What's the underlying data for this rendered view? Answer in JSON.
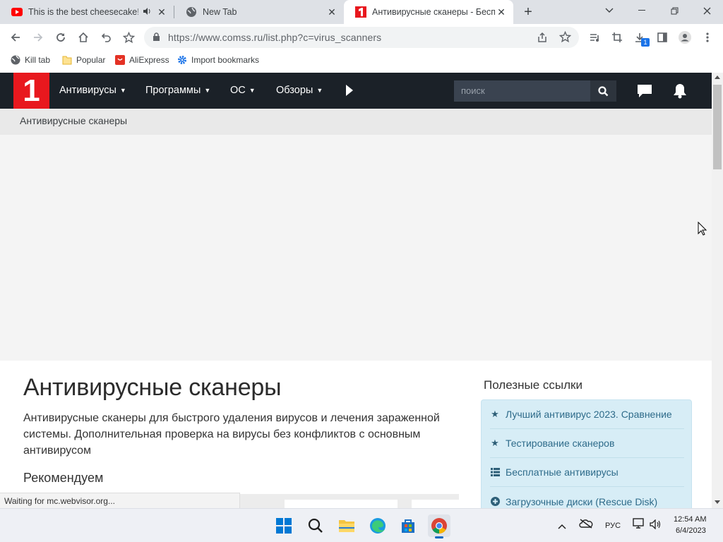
{
  "browser": {
    "tabs": [
      {
        "title": "This is the best cheesecake!!",
        "favicon": "youtube-icon",
        "audio": true,
        "active": false
      },
      {
        "title": "New Tab",
        "favicon": "globe-icon",
        "active": false
      },
      {
        "title": "Антивирусные сканеры - Беспл",
        "favicon": "comss-icon",
        "active": true
      }
    ],
    "url": "https://www.comss.ru/list.php?c=virus_scanners",
    "download_badge": "1",
    "bookmarks": [
      {
        "label": "Kill tab",
        "icon": "globe-icon"
      },
      {
        "label": "Popular",
        "icon": "folder-icon"
      },
      {
        "label": "AliExpress",
        "icon": "aliexpress-icon"
      },
      {
        "label": "Import bookmarks",
        "icon": "gear-icon"
      }
    ]
  },
  "site": {
    "logo_text": "1",
    "nav": [
      {
        "label": "Антивирусы"
      },
      {
        "label": "Программы"
      },
      {
        "label": "ОС"
      },
      {
        "label": "Обзоры"
      }
    ],
    "search_placeholder": "поиск",
    "breadcrumb": "Антивирусные сканеры",
    "page_title": "Антивирусные сканеры",
    "lead": "Антивирусные сканеры для быстрого удаления вирусов и лечения зараженной системы. Дополнительная проверка на вирусы без конфликтов с основным антивирусом",
    "recommended_heading": "Рекомендуем",
    "sidebar": {
      "title": "Полезные ссылки",
      "links": [
        {
          "label": "Лучший антивирус 2023. Сравнение",
          "icon": "star-icon"
        },
        {
          "label": "Тестирование сканеров",
          "icon": "star-icon"
        },
        {
          "label": "Бесплатные антивирусы",
          "icon": "list-icon"
        },
        {
          "label": "Загрузочные диски (Rescue Disk)",
          "icon": "plus-circle-icon"
        }
      ]
    }
  },
  "status_text": "Waiting for mc.webvisor.org...",
  "taskbar": {
    "lang": "РУС",
    "time": "12:54 AM",
    "date": "6/4/2023"
  },
  "colors": {
    "site_nav_bg": "#1b2128",
    "logo_red": "#e8181e",
    "sidebar_bg": "#d7edf6",
    "sidebar_link": "#2e6b8a"
  }
}
